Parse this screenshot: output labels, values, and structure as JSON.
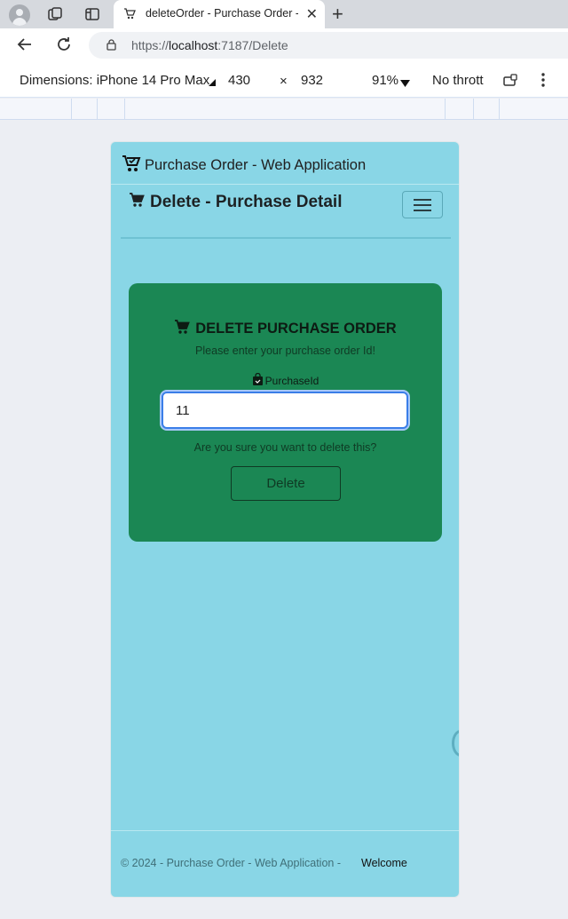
{
  "browser": {
    "tab_title": "deleteOrder - Purchase Order - Web Application",
    "url_prefix": "https://",
    "url_host": "localhost",
    "url_path": ":7187/Delete"
  },
  "devtools": {
    "dimensions_label": "Dimensions: iPhone 14 Pro Max",
    "width": "430",
    "times": "×",
    "height": "932",
    "zoom": "91%",
    "throttle": "No thrott"
  },
  "app": {
    "brand": "Purchase Order - Web Application",
    "page_title": "Delete - Purchase Detail",
    "card": {
      "title": "DELETE PURCHASE ORDER",
      "subtitle": "Please enter your purchase order Id!",
      "field_label": "PurchaseId",
      "field_value": "11",
      "confirm_text": "Are you sure you want to delete this?",
      "delete_label": "Delete"
    },
    "footer": "© 2024 - Purchase Order - Web Application -",
    "welcome": "Welcome"
  },
  "colors": {
    "app_background": "#89d6e6",
    "card_background": "#1b8754",
    "input_focus": "#3b7ee8"
  }
}
